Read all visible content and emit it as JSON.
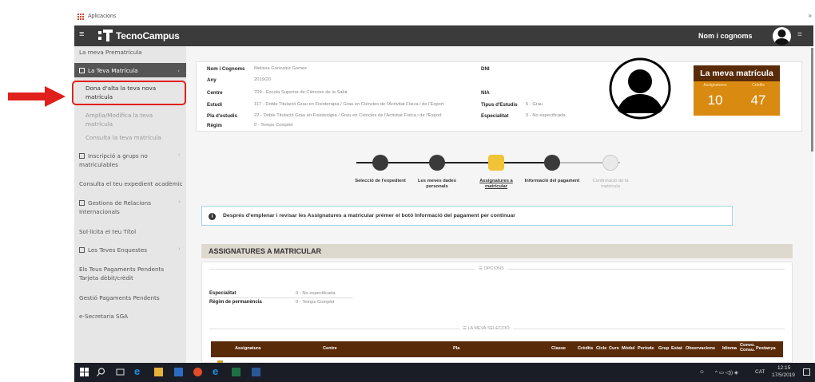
{
  "browser": {
    "bookmark": "Aplicacions"
  },
  "header": {
    "logo": "TecnoCampus",
    "user": "Nom i cognoms"
  },
  "sidebar": {
    "items": [
      {
        "label": "La meva Prematrícula"
      },
      {
        "label": "La Teva Matrícula"
      },
      {
        "label": "Dona d'alta la teva nova matrícula"
      },
      {
        "label": "Amplia/Modifica la teva matrícula"
      },
      {
        "label": "Consulta la teva matrícula"
      },
      {
        "label": "Inscripció a grups no matriculables"
      },
      {
        "label": "Consulta el teu expedient acadèmic"
      },
      {
        "label": "Gestions de Relacions Internacionals"
      },
      {
        "label": "Sol·licita el teu Títol"
      },
      {
        "label": "Les Teves Enquestes"
      },
      {
        "label": "Els Teus Pagaments Pendents Tarjeta dèbit/crèdit"
      },
      {
        "label": "Gestió Pagaments Pendents"
      },
      {
        "label": "e-Secretaria SGA"
      }
    ]
  },
  "student": {
    "nom_label": "Nom i Cognoms",
    "nom_value": "Melissa Gonzalez Gomez",
    "dni_label": "DNI",
    "any_label": "Any",
    "any_value": "2019/20",
    "centre_label": "Centre",
    "centre_value": "709 - Escola Superior de Ciències de la Salut",
    "nia_label": "NIA",
    "estudi_label": "Estudi",
    "estudi_value": "117 - Doble Titulació Grau en Fisioteràpia / Grau en Ciències de l'Activitat Física i de l'Esport",
    "tipus_label": "Tipus d'Estudis",
    "tipus_value": "5 - Grau",
    "pla_label": "Pla d'estudis",
    "pla_value": "22 - Doble Titulació Grau en Fisioteràpia / Grau en Ciències de l'Activitat Física i de l'Esport",
    "esp_label": "Especialitat",
    "esp_value": "0 - No especificada",
    "regim_label": "Règim",
    "regim_value": "0 - Temps Complet"
  },
  "summary": {
    "title": "La meva matrícula",
    "assig_label": "Assignatures",
    "assig_value": "10",
    "credits_label": "Crèdits",
    "credits_value": "47"
  },
  "steps": [
    {
      "label": "Selecció de l'expedient"
    },
    {
      "label": "Les meves dades personals"
    },
    {
      "label": "Assignatures a matricular"
    },
    {
      "label": "Informació del pagament"
    },
    {
      "label": "Confirmació de la matrícula"
    }
  ],
  "info": "Després d'emplenar i revisar les Assignatures a matricular prémer el botó Informació del pagament per continuar",
  "section": "ASSIGNATURES A MATRICULAR",
  "opcions": {
    "title": "☰ OPCIONS",
    "esp_label": "Especialitat",
    "esp_value": "0 - No especificada",
    "regim_label": "Règim de permanència",
    "regim_value": "0 - Temps Complet"
  },
  "seleccio_title": "☰ LA MEVA SELECCIÓ",
  "table_headers": [
    "Assignatura",
    "Centre",
    "Pla",
    "Classe",
    "Crèdits",
    "Cicle",
    "Curs",
    "Mòdul",
    "Període",
    "Grup",
    "Estat",
    "Observacions",
    "Idioma",
    "Convo. Consu.",
    "Pestanya"
  ],
  "taskbar": {
    "lang": "CAT",
    "time": "12:15",
    "date": "17/5/2019"
  },
  "colors": {
    "header": "#3b3b3b",
    "brown": "#5a2b09",
    "orange": "#d98a10",
    "highlight": "#e0201a"
  }
}
